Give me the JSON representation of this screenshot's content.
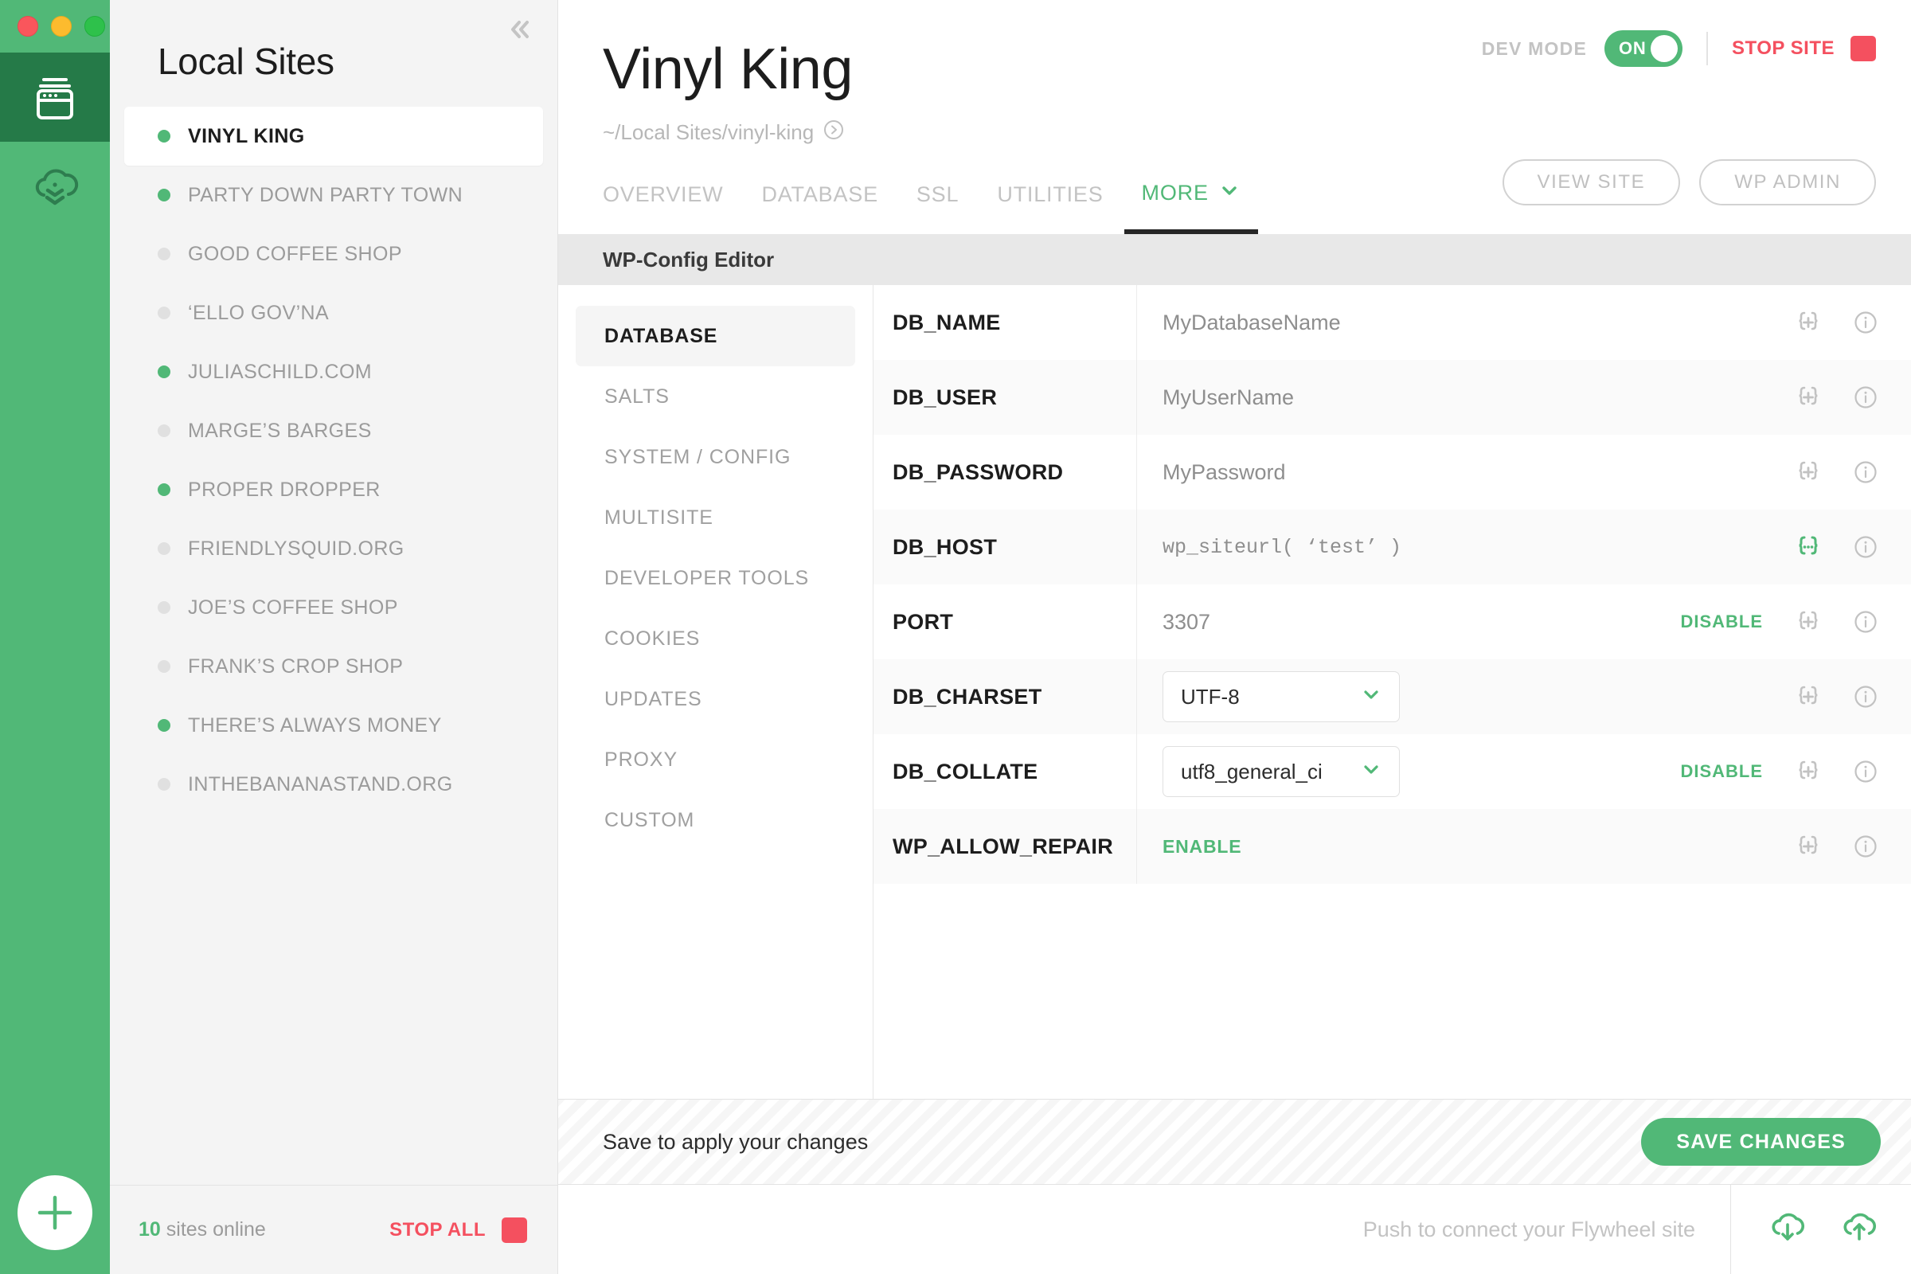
{
  "window": {
    "traffic_lights": [
      "close",
      "minimize",
      "zoom"
    ]
  },
  "rail": {
    "items": [
      {
        "icon": "local-sites-icon",
        "active": true
      },
      {
        "icon": "cloud-pull-icon",
        "active": false
      }
    ],
    "add_site_icon": "plus-icon"
  },
  "sidebar": {
    "title": "Local Sites",
    "collapse_icon": "chevron-double-left-icon",
    "sites": [
      {
        "label": "VINYL KING",
        "status": "on",
        "selected": true
      },
      {
        "label": "PARTY DOWN PARTY TOWN",
        "status": "on",
        "selected": false
      },
      {
        "label": "GOOD COFFEE SHOP",
        "status": "off",
        "selected": false
      },
      {
        "label": "‘ELLO GOV’NA",
        "status": "off",
        "selected": false
      },
      {
        "label": "JULIASCHILD.COM",
        "status": "on",
        "selected": false
      },
      {
        "label": "MARGE’S BARGES",
        "status": "off",
        "selected": false
      },
      {
        "label": "PROPER DROPPER",
        "status": "on",
        "selected": false
      },
      {
        "label": "FRIENDLYSQUID.ORG",
        "status": "off",
        "selected": false
      },
      {
        "label": "JOE’S COFFEE SHOP",
        "status": "off",
        "selected": false
      },
      {
        "label": "FRANK’S CROP SHOP",
        "status": "off",
        "selected": false
      },
      {
        "label": "THERE’S ALWAYS MONEY",
        "status": "on",
        "selected": false
      },
      {
        "label": "INTHEBANANASTAND.ORG",
        "status": "off",
        "selected": false
      }
    ],
    "footer": {
      "count": "10",
      "count_suffix": " sites online",
      "stop_all_label": "STOP ALL"
    }
  },
  "header": {
    "dev_mode_label": "DEV MODE",
    "dev_mode_state": "ON",
    "stop_site_label": "STOP SITE",
    "site_title": "Vinyl King",
    "site_path": "~/Local Sites/vinyl-king",
    "path_icon": "arrow-circle-right-icon",
    "tabs": [
      {
        "label": "OVERVIEW",
        "active": false,
        "caret": false
      },
      {
        "label": "DATABASE",
        "active": false,
        "caret": false
      },
      {
        "label": "SSL",
        "active": false,
        "caret": false
      },
      {
        "label": "UTILITIES",
        "active": false,
        "caret": false
      },
      {
        "label": "MORE",
        "active": true,
        "caret": true
      }
    ],
    "view_site_label": "VIEW SITE",
    "wp_admin_label": "WP ADMIN"
  },
  "panel": {
    "title": "WP-Config Editor",
    "nav": [
      {
        "label": "DATABASE",
        "active": true
      },
      {
        "label": "SALTS",
        "active": false
      },
      {
        "label": "SYSTEM / CONFIG",
        "active": false
      },
      {
        "label": "MULTISITE",
        "active": false
      },
      {
        "label": "DEVELOPER TOOLS",
        "active": false
      },
      {
        "label": "COOKIES",
        "active": false
      },
      {
        "label": "UPDATES",
        "active": false
      },
      {
        "label": "PROXY",
        "active": false
      },
      {
        "label": "CUSTOM",
        "active": false
      }
    ],
    "rows": [
      {
        "key": "DB_NAME",
        "value": "MyDatabaseName",
        "value_type": "text",
        "mono": false,
        "action_label": "",
        "brace_icon": "braces-plus-icon",
        "brace_active": false,
        "info_icon": "info-circle-icon"
      },
      {
        "key": "DB_USER",
        "value": "MyUserName",
        "value_type": "text",
        "mono": false,
        "action_label": "",
        "brace_icon": "braces-plus-icon",
        "brace_active": false,
        "info_icon": "info-circle-icon"
      },
      {
        "key": "DB_PASSWORD",
        "value": "MyPassword",
        "value_type": "text",
        "mono": false,
        "action_label": "",
        "brace_icon": "braces-plus-icon",
        "brace_active": false,
        "info_icon": "info-circle-icon"
      },
      {
        "key": "DB_HOST",
        "value": "wp_siteurl( ‘test’ )",
        "value_type": "text",
        "mono": true,
        "action_label": "",
        "brace_icon": "braces-dots-icon",
        "brace_active": true,
        "info_icon": "info-circle-icon"
      },
      {
        "key": "PORT",
        "value": "3307",
        "value_type": "text",
        "mono": false,
        "action_label": "DISABLE",
        "brace_icon": "braces-plus-icon",
        "brace_active": false,
        "info_icon": "info-circle-icon"
      },
      {
        "key": "DB_CHARSET",
        "value": "UTF-8",
        "value_type": "select",
        "mono": false,
        "action_label": "",
        "brace_icon": "braces-plus-icon",
        "brace_active": false,
        "info_icon": "info-circle-icon"
      },
      {
        "key": "DB_COLLATE",
        "value": "utf8_general_ci",
        "value_type": "select",
        "mono": false,
        "action_label": "DISABLE",
        "brace_icon": "braces-plus-icon",
        "brace_active": false,
        "info_icon": "info-circle-icon"
      },
      {
        "key": "WP_ALLOW_REPAIR",
        "value": "ENABLE",
        "value_type": "enable",
        "mono": false,
        "action_label": "",
        "brace_icon": "braces-plus-icon",
        "brace_active": false,
        "info_icon": "info-circle-icon"
      }
    ]
  },
  "save_bar": {
    "message": "Save to apply your changes",
    "button_label": "SAVE CHANGES"
  },
  "push_bar": {
    "message": "Push to connect your Flywheel site",
    "pull_icon": "cloud-download-icon",
    "push_icon": "cloud-upload-icon"
  },
  "colors": {
    "brand_green": "#51b877",
    "dark_green": "#257a48",
    "danger_red": "#f4505f",
    "muted_gray": "#9b9b9b",
    "panel_gray": "#e8e8e8"
  }
}
